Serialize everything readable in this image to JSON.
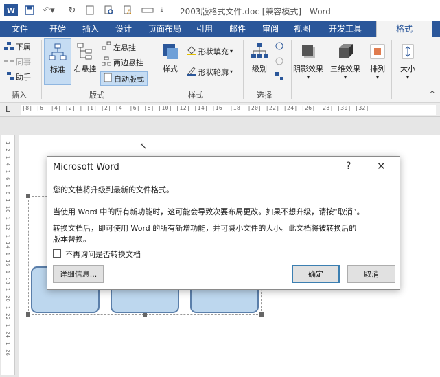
{
  "window": {
    "title": "2003版格式文件.doc [兼容模式] - Word"
  },
  "ribbon_tabs": [
    "文件",
    "开始",
    "插入",
    "设计",
    "页面布局",
    "引用",
    "邮件",
    "审阅",
    "视图",
    "开发工具",
    "格式"
  ],
  "ribbon": {
    "insert_group": {
      "label": "插入",
      "items": [
        "下属",
        "同事",
        "助手"
      ]
    },
    "layout_group": {
      "label": "版式",
      "standard": "标准",
      "right_hanging": "右悬挂",
      "left_hanging": "左悬挂",
      "both_hanging": "两边悬挂",
      "auto_layout": "自动版式"
    },
    "style_group": {
      "label": "样式",
      "style": "样式",
      "shape_fill": "形状填充",
      "shape_outline": "形状轮廓"
    },
    "select_group": {
      "label": "选择",
      "level": "级别"
    },
    "shadow": "阴影效果",
    "three_d": "三维效果",
    "arrange": "排列",
    "size": "大小"
  },
  "ruler": {
    "marks": "|8| |6| |4| |2| | |1| |2| |4| |6| |8| |10| |12| |14| |16| |18| |20| |22| |24| |26| |28| |30| |32|",
    "vertical_marks": "1 2 1 4 1 6 1 8 1 10 1 12 1 14 1 16 1 18 1 20 1 22 1 24 1 26"
  },
  "dialog": {
    "title": "Microsoft Word",
    "help": "?",
    "close": "✕",
    "line1": "您的文档将升级到最新的文件格式。",
    "line2": "当使用 Word 中的所有新功能时，这可能会导致次要布局更改。如果不想升级，请按“取消”。",
    "line3a": "转换文档后，即可使用 Word 的所有新增功能，并可减小文件的大小。此文档将被转换后的",
    "line3b": "版本替换。",
    "checkbox_label": "不再询问是否转换文档",
    "details_button": "详细信息...",
    "ok_button": "确定",
    "cancel_button": "取消"
  },
  "colors": {
    "accent": "#2b579a",
    "smartart_fill": "#bdd7ee",
    "smartart_border": "#5b7faa"
  }
}
